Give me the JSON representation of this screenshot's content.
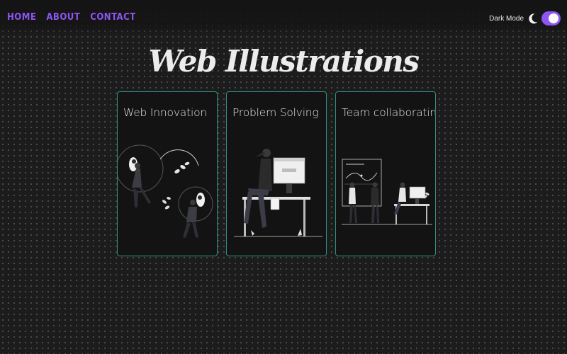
{
  "nav": {
    "links": [
      {
        "label": "HOME"
      },
      {
        "label": "ABOUT"
      },
      {
        "label": "CONTACT"
      }
    ]
  },
  "theme": {
    "label": "Dark Mode",
    "enabled": true,
    "icon": "moon-icon"
  },
  "page": {
    "title": "Web Illustrations"
  },
  "cards": [
    {
      "title": "Web Innovation"
    },
    {
      "title": "Problem Solving"
    },
    {
      "title": "Team collaborating"
    }
  ],
  "colors": {
    "accent": "#8e55f2",
    "card_border": "#2f8f80",
    "background": "#1c1c1c"
  }
}
